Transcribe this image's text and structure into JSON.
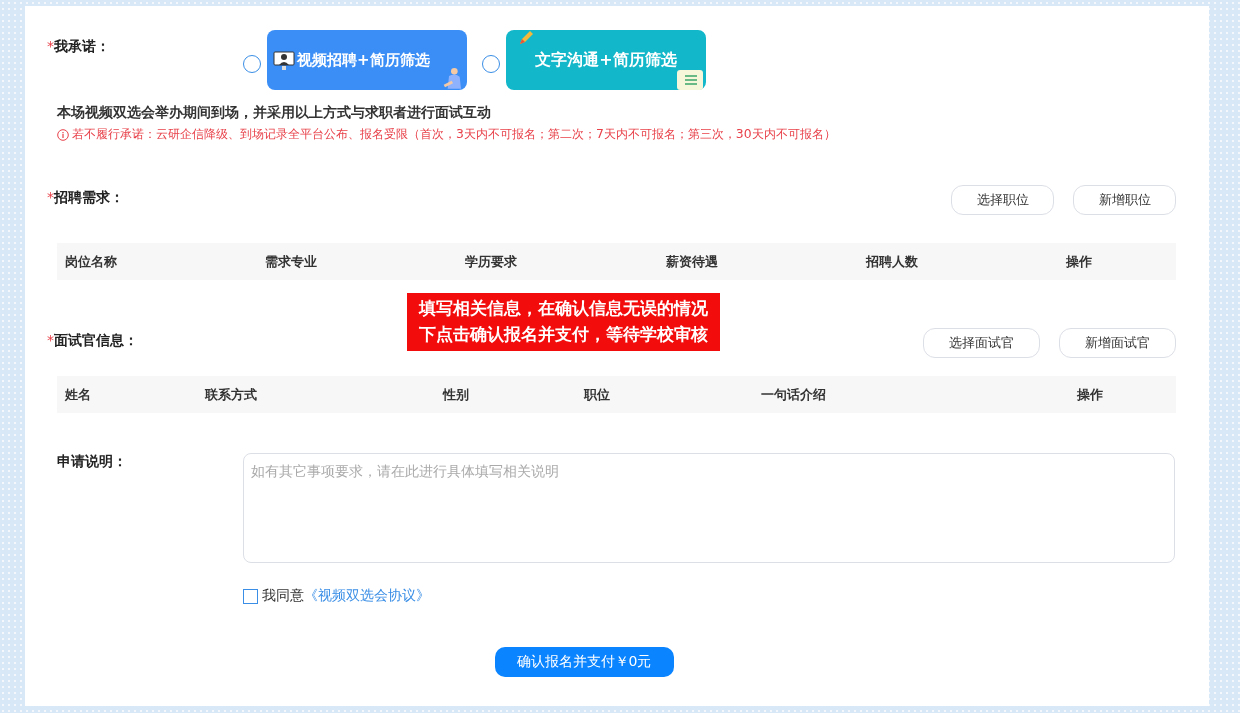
{
  "pledge": {
    "label": "我承诺：",
    "required_mark": "*",
    "options": [
      {
        "kind": "video",
        "label": "视频招聘+简历筛选",
        "selected": false
      },
      {
        "kind": "text",
        "label": "文字沟通+简历筛选",
        "selected": false
      }
    ],
    "statement": "本场视频双选会举办期间到场，并采用以上方式与求职者进行面试互动",
    "warning": "若不履行承诺：云研企信降级、到场记录全平台公布、报名受限（首次，3天内不可报名；第二次；7天内不可报名；第三次，30天内不可报名）"
  },
  "recruitment": {
    "label": "招聘需求：",
    "required_mark": "*",
    "buttons": [
      "选择职位",
      "新增职位"
    ],
    "table": {
      "columns": [
        "岗位名称",
        "需求专业",
        "学历要求",
        "薪资待遇",
        "招聘人数",
        "操作"
      ]
    }
  },
  "interviewers": {
    "label": "面试官信息：",
    "required_mark": "*",
    "buttons": [
      "选择面试官",
      "新增面试官"
    ],
    "table": {
      "columns": [
        "姓名",
        "联系方式",
        "性别",
        "职位",
        "一句话介绍",
        "操作"
      ]
    }
  },
  "application": {
    "label": "申请说明：",
    "placeholder": "如有其它事项要求，请在此进行具体填写相关说明"
  },
  "agreement": {
    "checked": false,
    "text": "我同意",
    "link": "《视频双选会协议》"
  },
  "submit": "确认报名并支付￥0元",
  "callout": [
    "填写相关信息，在确认信息无误的情况",
    "下点击确认报名并支付，等待学校审核"
  ]
}
